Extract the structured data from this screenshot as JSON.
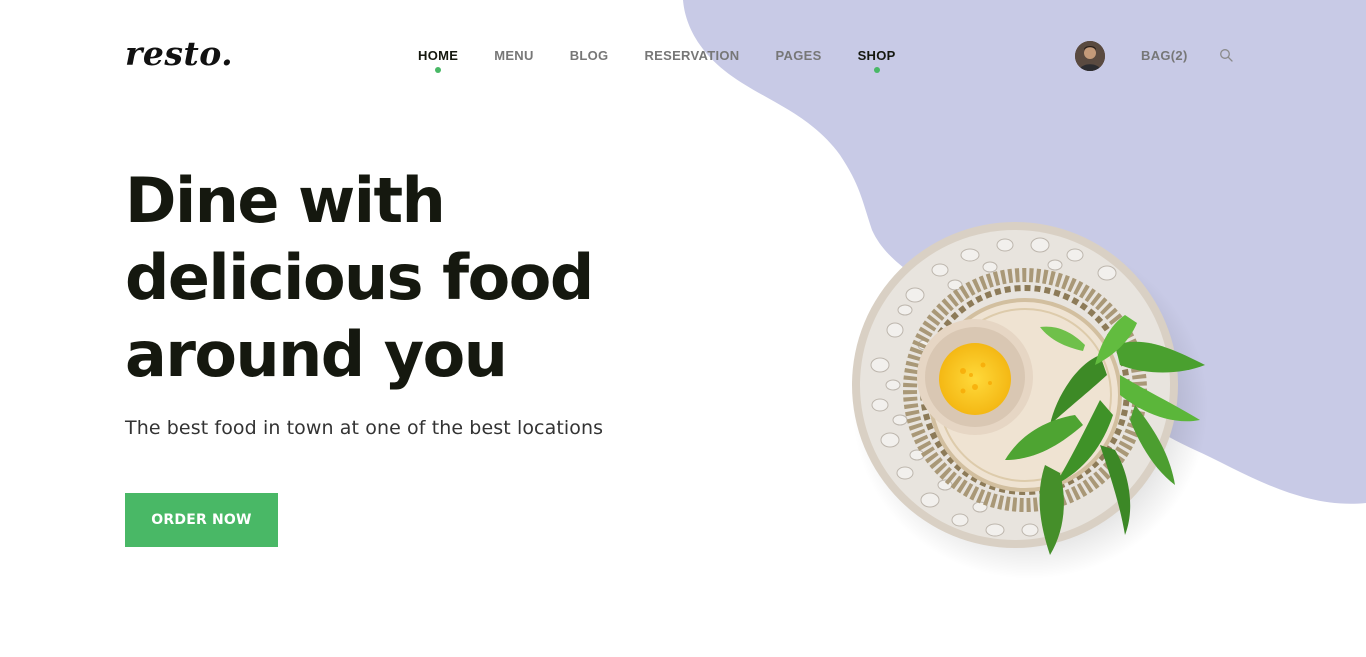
{
  "brand": {
    "logo": "resto."
  },
  "nav": {
    "items": [
      {
        "label": "HOME",
        "active": true,
        "dot": true
      },
      {
        "label": "MENU",
        "active": false,
        "dot": false
      },
      {
        "label": "BLOG",
        "active": false,
        "dot": false
      },
      {
        "label": "RESERVATION",
        "active": false,
        "dot": false
      },
      {
        "label": "PAGES",
        "active": false,
        "dot": false
      },
      {
        "label": "SHOP",
        "active": true,
        "dot": true
      }
    ]
  },
  "header": {
    "bag_label": "BAG(2)"
  },
  "hero": {
    "title_lines": [
      "Dine with",
      "delicious food",
      "around you"
    ],
    "subtitle": "The best food in town at one of the best locations",
    "cta_label": "ORDER NOW"
  },
  "colors": {
    "accent": "#49b866",
    "blob": "#c8cae6",
    "heading": "#15180f",
    "nav_inactive": "#777777"
  },
  "icons": {
    "search": "search-icon",
    "avatar": "user-avatar"
  }
}
